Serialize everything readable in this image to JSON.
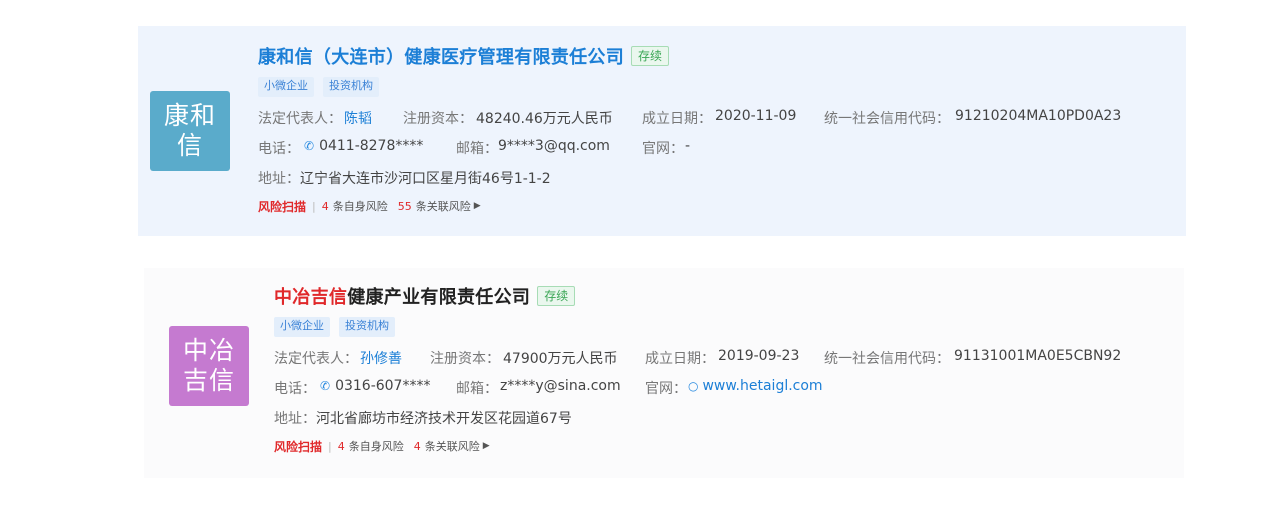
{
  "companies": [
    {
      "logo_line1": "康和",
      "logo_line2": "信",
      "logo_color": "#5aabcb",
      "name_highlight": "",
      "name_rest": "康和信（大连市）健康医疗管理有限责任公司",
      "status": "存续",
      "tags": [
        "小微企业",
        "投资机构"
      ],
      "legal_rep_label": "法定代表人：",
      "legal_rep": "陈韬",
      "capital_label": "注册资本：",
      "capital": "48240.46万元人民币",
      "date_label": "成立日期：",
      "date": "2020-11-09",
      "credit_label": "统一社会信用代码：",
      "credit_code": "91210204MA10PD0A23",
      "phone_label": "电话：",
      "phone": "0411-8278****",
      "email_label": "邮箱：",
      "email": "9****3@qq.com",
      "website_label": "官网：",
      "website": "-",
      "address_label": "地址：",
      "address": "辽宁省大连市沙河口区星月街46号1-1-2",
      "risk_scan": "风险扫描",
      "risk_self_count": "4",
      "risk_self_label": "条自身风险",
      "risk_related_count": "55",
      "risk_related_label": "条关联风险"
    },
    {
      "logo_line1": "中冶",
      "logo_line2": "吉信",
      "logo_color": "#c57ad0",
      "name_highlight": "中冶吉信",
      "name_rest": "健康产业有限责任公司",
      "status": "存续",
      "tags": [
        "小微企业",
        "投资机构"
      ],
      "legal_rep_label": "法定代表人：",
      "legal_rep": "孙修善",
      "capital_label": "注册资本：",
      "capital": "47900万元人民币",
      "date_label": "成立日期：",
      "date": "2019-09-23",
      "credit_label": "统一社会信用代码：",
      "credit_code": "91131001MA0E5CBN92",
      "phone_label": "电话：",
      "phone": "0316-607****",
      "email_label": "邮箱：",
      "email": "z****y@sina.com",
      "website_label": "官网：",
      "website": "www.hetaigl.com",
      "address_label": "地址：",
      "address": "河北省廊坊市经济技术开发区花园道67号",
      "risk_scan": "风险扫描",
      "risk_self_count": "4",
      "risk_self_label": "条自身风险",
      "risk_related_count": "4",
      "risk_related_label": "条关联风险"
    }
  ]
}
